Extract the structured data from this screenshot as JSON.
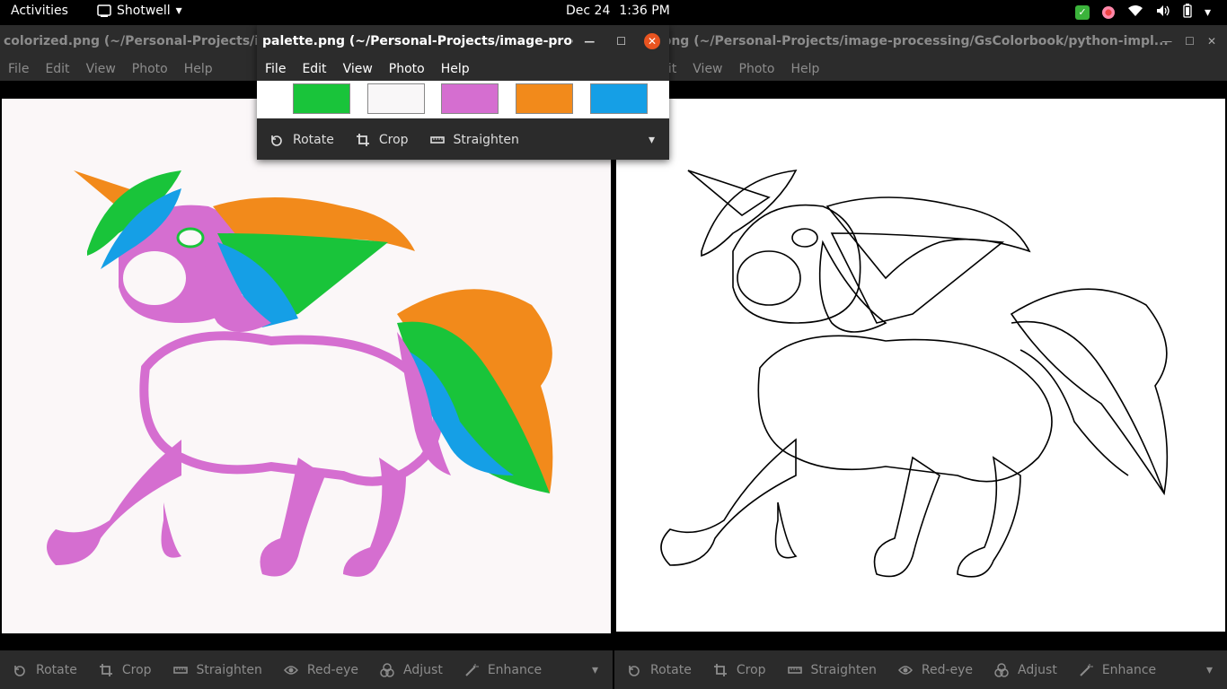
{
  "topbar": {
    "activities": "Activities",
    "app_name": "Shotwell",
    "date": "Dec 24",
    "time": "1:36 PM"
  },
  "left_window": {
    "title": "colorized.png (~/Personal-Projects/imag",
    "menu": [
      "File",
      "Edit",
      "View",
      "Photo",
      "Help"
    ],
    "toolbar": [
      "Rotate",
      "Crop",
      "Straighten",
      "Red-eye",
      "Adjust",
      "Enhance"
    ]
  },
  "right_window": {
    "title": ".png (~/Personal-Projects/image-processing/GsColorbook/python-impl...",
    "menu": [
      "lit",
      "View",
      "Photo",
      "Help"
    ],
    "toolbar": [
      "Rotate",
      "Crop",
      "Straighten",
      "Red-eye",
      "Adjust",
      "Enhance"
    ]
  },
  "popup": {
    "title": "palette.png (~/Personal-Projects/image-proces...",
    "menu": [
      "File",
      "Edit",
      "View",
      "Photo",
      "Help"
    ],
    "toolbar": [
      "Rotate",
      "Crop",
      "Straighten"
    ],
    "palette": [
      "#19c43a",
      "#f9f7f8",
      "#d56ed0",
      "#f28a1b",
      "#159fe6"
    ]
  }
}
